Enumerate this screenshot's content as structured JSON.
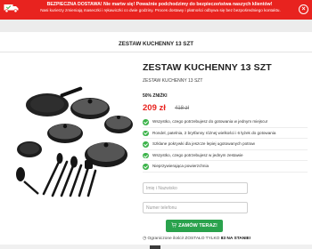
{
  "banner": {
    "line1": "BEZPIECZNA DOSTAWA! Nie martw się! Poważnie podchodzimy do bezpieczeństwa naszych klientów!",
    "line2": "Nasi kurierzy zmieniają maseczki i rękawiczki co dwie godziny. Proces dostawy i płatności odbywa się bez bezpośredniego kontaktu.",
    "close_label": "×",
    "color": "#e8231f"
  },
  "header": {
    "title": "ZESTAW KUCHENNY 13 SZT"
  },
  "product": {
    "title": "ZESTAW KUCHENNY 13 SZT",
    "subtitle": "ZESTAW KUCHENNY 13 SZT",
    "discount": "50% ZNIŻKI",
    "price_new": "209 zł",
    "price_old": "418 zł",
    "features": [
      "Wszystko, czego potrzebujesz do gotowania w jednym miejscu!",
      "Rondel, patelnia, 2 brytfanny różnej wielkości i 6 łyżek do gotowania",
      "Szklane pokrywki dla jeszcze lepiej ugotowanych potraw",
      "Wszystko, czego potrzebujesz w jednym zestawie",
      "Nieprzywierająca powierzchnia"
    ]
  },
  "form": {
    "name_placeholder": "Imię i Nazwisko",
    "phone_placeholder": "Numer telefonu",
    "submit_label": "ZAMÓW TERAZ!",
    "limited_prefix": "Ograniczone ilości! ZOSTAŁO TYLKO",
    "limited_count": "83 NA STANIE!"
  },
  "colors": {
    "accent": "#e8231f",
    "button": "#2aa24d",
    "check": "#3cb34a"
  }
}
